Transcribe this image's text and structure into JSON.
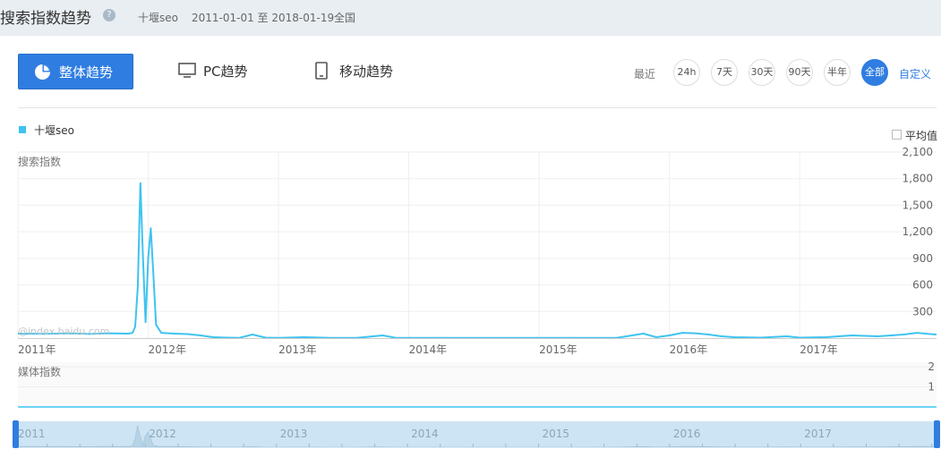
{
  "header": {
    "title": "搜索指数趋势",
    "help_icon": "?",
    "keyword": "十堰seo",
    "date_range": "2011-01-01 至 2018-01-19",
    "region": "全国"
  },
  "tabs": [
    {
      "label": "整体趋势",
      "icon": "pie-chart-icon",
      "active": true
    },
    {
      "label": "PC趋势",
      "icon": "monitor-icon",
      "active": false
    },
    {
      "label": "移动趋势",
      "icon": "mobile-icon",
      "active": false
    }
  ],
  "range": {
    "label": "最近",
    "buttons": [
      {
        "label": "24h",
        "active": false
      },
      {
        "label": "7天",
        "active": false
      },
      {
        "label": "30天",
        "active": false
      },
      {
        "label": "90天",
        "active": false
      },
      {
        "label": "半年",
        "active": false
      },
      {
        "label": "全部",
        "active": true
      }
    ],
    "custom": "自定义"
  },
  "legend": {
    "series_name": "十堰seo",
    "average_label": "平均值"
  },
  "watermark": "@index.baidu.com",
  "colors": {
    "accent": "#2f7de1",
    "series": "#3ec3f0",
    "topbar": "#e9eef2"
  },
  "chart_data": [
    {
      "type": "line",
      "ylabel": "搜索指数",
      "series": [
        {
          "name": "十堰seo"
        }
      ],
      "ylim": [
        0,
        2100
      ],
      "y_ticks": [
        300,
        600,
        900,
        1200,
        1500,
        1800,
        2100
      ],
      "y_tick_labels": [
        "300",
        "600",
        "900",
        "1,200",
        "1,500",
        "1,800",
        "2,100"
      ],
      "x_ticks": [
        2011,
        2012,
        2013,
        2014,
        2015,
        2016,
        2017
      ],
      "x_tick_labels": [
        "2011年",
        "2012年",
        "2013年",
        "2014年",
        "2015年",
        "2016年",
        "2017年"
      ],
      "xlim": [
        2011.0,
        2018.05
      ],
      "grid": true,
      "points": [
        [
          2011.0,
          50
        ],
        [
          2011.2,
          48
        ],
        [
          2011.4,
          52
        ],
        [
          2011.55,
          46
        ],
        [
          2011.7,
          55
        ],
        [
          2011.85,
          50
        ],
        [
          2011.88,
          60
        ],
        [
          2011.9,
          130
        ],
        [
          2011.92,
          580
        ],
        [
          2011.94,
          1750
        ],
        [
          2011.96,
          900
        ],
        [
          2011.98,
          180
        ],
        [
          2012.0,
          900
        ],
        [
          2012.02,
          1240
        ],
        [
          2012.04,
          700
        ],
        [
          2012.06,
          150
        ],
        [
          2012.1,
          60
        ],
        [
          2012.2,
          50
        ],
        [
          2012.3,
          45
        ],
        [
          2012.4,
          30
        ],
        [
          2012.5,
          10
        ],
        [
          2012.6,
          5
        ],
        [
          2012.7,
          3
        ],
        [
          2012.8,
          40
        ],
        [
          2012.9,
          5
        ],
        [
          2013.0,
          3
        ],
        [
          2013.2,
          10
        ],
        [
          2013.4,
          3
        ],
        [
          2013.6,
          2
        ],
        [
          2013.8,
          30
        ],
        [
          2013.9,
          3
        ],
        [
          2014.2,
          2
        ],
        [
          2014.6,
          2
        ],
        [
          2014.9,
          3
        ],
        [
          2015.0,
          2
        ],
        [
          2015.3,
          3
        ],
        [
          2015.6,
          4
        ],
        [
          2015.8,
          50
        ],
        [
          2015.9,
          10
        ],
        [
          2016.0,
          30
        ],
        [
          2016.1,
          60
        ],
        [
          2016.2,
          55
        ],
        [
          2016.3,
          40
        ],
        [
          2016.4,
          20
        ],
        [
          2016.5,
          10
        ],
        [
          2016.7,
          5
        ],
        [
          2016.9,
          20
        ],
        [
          2017.0,
          5
        ],
        [
          2017.2,
          10
        ],
        [
          2017.4,
          30
        ],
        [
          2017.6,
          20
        ],
        [
          2017.8,
          40
        ],
        [
          2017.9,
          60
        ],
        [
          2018.0,
          45
        ],
        [
          2018.05,
          40
        ]
      ]
    },
    {
      "type": "line",
      "ylabel": "媒体指数",
      "ylim": [
        0,
        2
      ],
      "y_ticks": [
        1,
        2
      ],
      "y_tick_labels": [
        "1",
        "2"
      ],
      "points": [
        [
          2011.0,
          0
        ],
        [
          2018.05,
          0
        ]
      ]
    }
  ],
  "navigator": {
    "labels": [
      "2011",
      "2012",
      "2013",
      "2014",
      "2015",
      "2016",
      "2017"
    ]
  }
}
